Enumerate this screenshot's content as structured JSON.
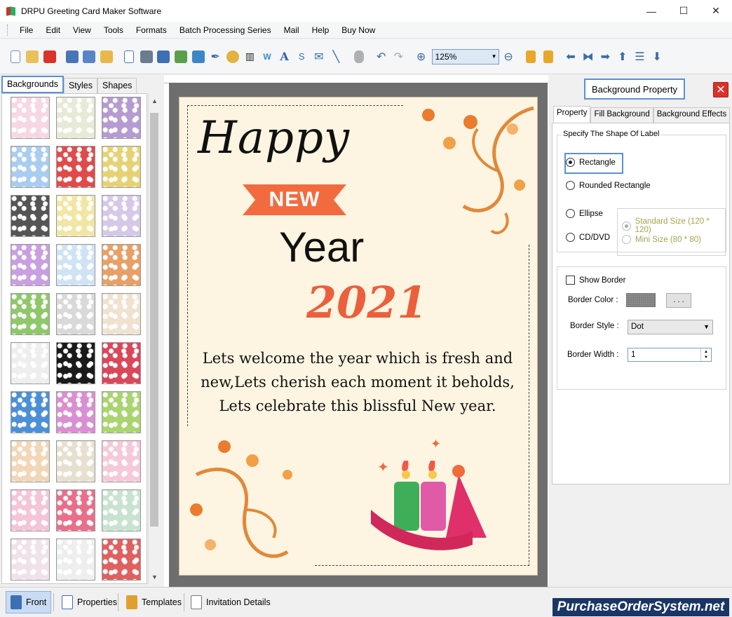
{
  "window": {
    "title": "DRPU Greeting Card Maker Software",
    "minimize": "—",
    "maximize": "☐",
    "close": "✕"
  },
  "menu": [
    "File",
    "Edit",
    "View",
    "Tools",
    "Formats",
    "Batch Processing Series",
    "Mail",
    "Help",
    "Buy Now"
  ],
  "toolbar": {
    "zoom_value": "125%",
    "icons": [
      "new-icon",
      "open-icon",
      "close-doc-icon",
      "save-icon",
      "save-as-icon",
      "export-icon",
      "properties-icon",
      "print-icon",
      "print-preview-icon",
      "image-edit-icon",
      "picture-icon",
      "pen-icon",
      "shapes-icon",
      "barcode-icon",
      "wordart-icon",
      "text-icon",
      "signature-icon",
      "email-icon",
      "line-icon",
      "database-icon",
      "undo-icon",
      "redo-icon",
      "zoom-in-icon",
      "zoom-out-icon",
      "lock-icon",
      "unlock-icon",
      "arrow-left-icon",
      "flip-icon",
      "arrow-right-icon",
      "arrow-up-icon",
      "align-icon",
      "arrow-down-icon"
    ]
  },
  "left_panel": {
    "tabs": [
      "Backgrounds",
      "Styles",
      "Shapes"
    ],
    "active_tab": "Backgrounds",
    "thumbnail_colors": [
      [
        "#f6d7e3",
        "#e7ead6",
        "#b59bd1"
      ],
      [
        "#a9cdf0",
        "#e14a4a",
        "#e6d275"
      ],
      [
        "#555555",
        "#f1e7a3",
        "#d6c8e8"
      ],
      [
        "#c99fe0",
        "#cfe3f5",
        "#e7a068"
      ],
      [
        "#8fc86a",
        "#d9d9d9",
        "#efe2cf"
      ],
      [
        "#eeeeee",
        "#1a1a1a",
        "#d9475a"
      ],
      [
        "#4c8fd6",
        "#d98fd1",
        "#a9d46f"
      ],
      [
        "#f1d7b8",
        "#e8e0cf",
        "#f5c9d9"
      ],
      [
        "#f4c4d8",
        "#e86f8a",
        "#c8e3d0"
      ],
      [
        "#f0e2e9",
        "#eeeeee",
        "#e06060"
      ]
    ]
  },
  "card": {
    "happy": "Happy",
    "new_label": "NEW",
    "year": "Year",
    "number": "2021",
    "message_lines": [
      "Lets welcome the year which is fresh and",
      "new,Lets cherish each moment it beholds,",
      "Lets celebrate this blissful New year."
    ],
    "accent_color": "#ec5f3c",
    "background_color": "#fdf5e2"
  },
  "right_panel": {
    "title": "Background Property",
    "tabs": [
      "Property",
      "Fill Background",
      "Background Effects"
    ],
    "active_tab": "Property",
    "shape_group_label": "Specify The Shape Of Label",
    "shapes": [
      "Rectangle",
      "Rounded Rectangle",
      "Ellipse",
      "CD/DVD"
    ],
    "selected_shape": "Rectangle",
    "cd_sizes": [
      "Standard Size (120 * 120)",
      "Mini Size (80 * 80)"
    ],
    "show_border_label": "Show Border",
    "border_color_label": "Border Color :",
    "border_color_button": ". . .",
    "border_style_label": "Border Style :",
    "border_style_value": "Dot",
    "border_width_label": "Border Width :",
    "border_width_value": "1"
  },
  "bottom_tabs": [
    "Front",
    "Properties",
    "Templates",
    "Invitation Details"
  ],
  "active_bottom_tab": "Front",
  "brand": "PurchaseOrderSystem.net"
}
